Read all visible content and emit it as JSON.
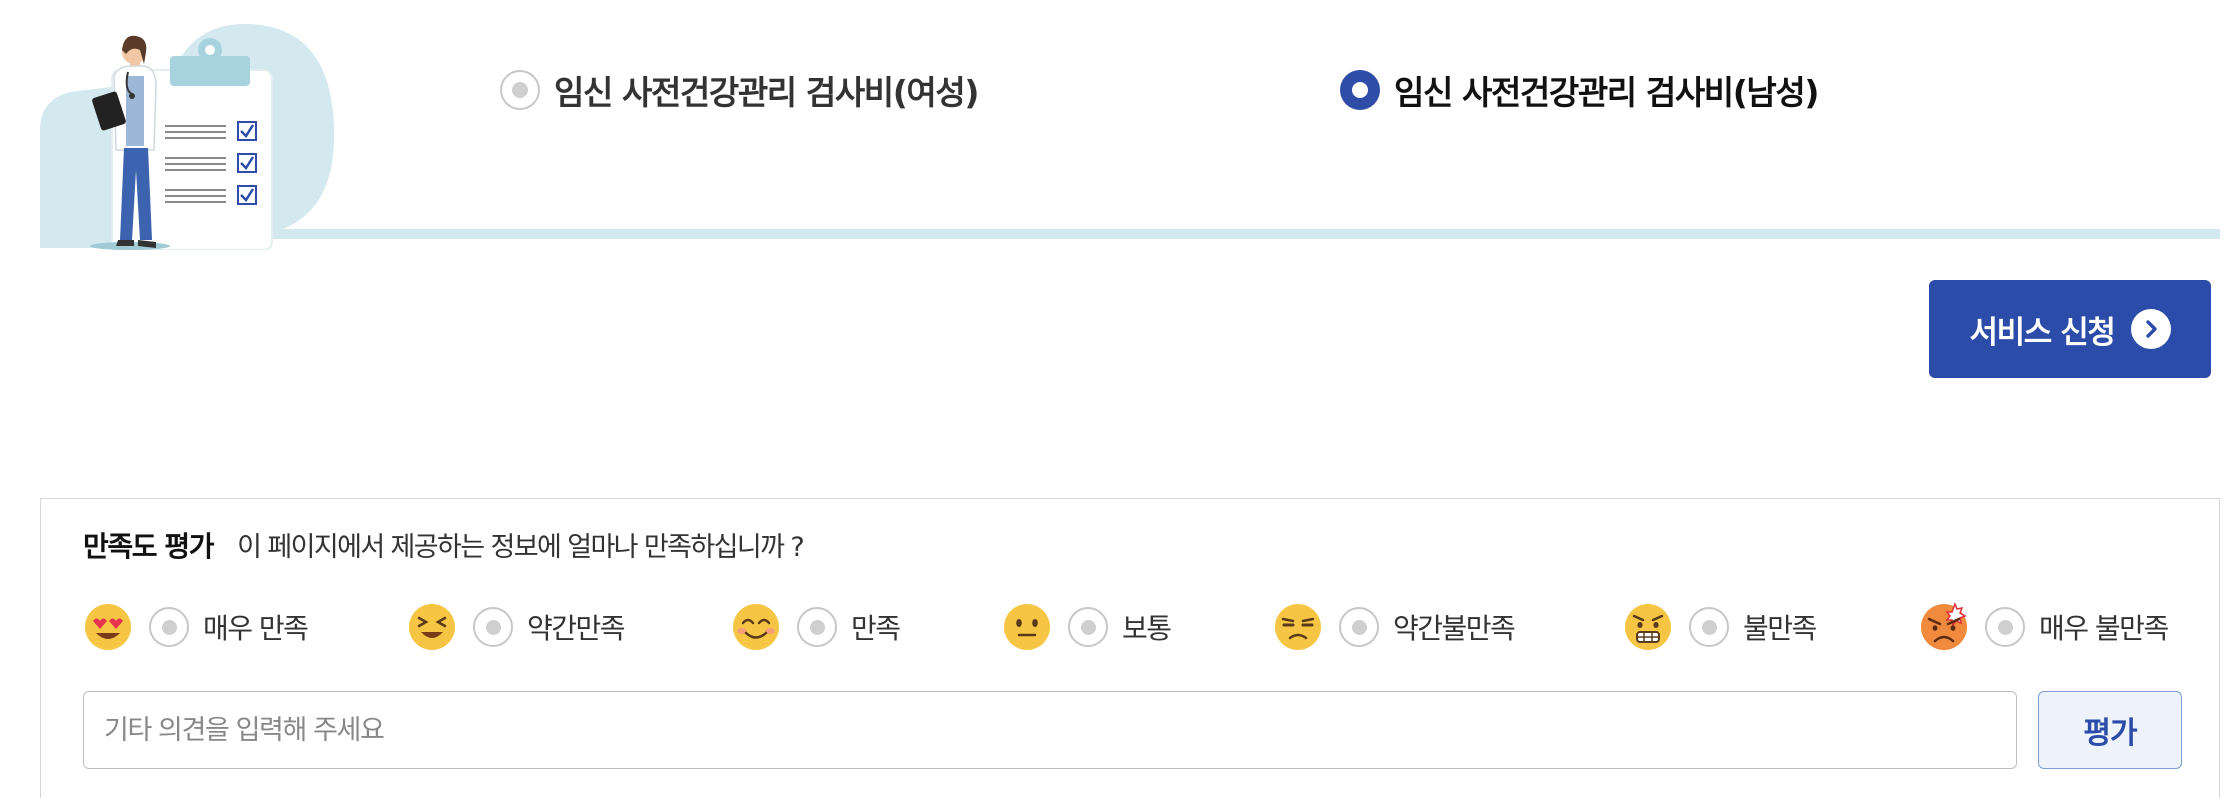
{
  "selection": {
    "options": [
      {
        "label": "임신 사전건강관리 검사비(여성)",
        "checked": false
      },
      {
        "label": "임신 사전건강관리 검사비(남성)",
        "checked": true
      }
    ]
  },
  "service_button": {
    "label": "서비스 신청",
    "icon": "chevron-right-icon"
  },
  "survey": {
    "title": "만족도 평가",
    "question": "이 페이지에서 제공하는 정보에 얼마나 만족하십니까 ?",
    "choices": [
      {
        "label": "매우 만족",
        "icon": "heart-eyes-face-icon"
      },
      {
        "label": "약간만족",
        "icon": "squinting-face-icon"
      },
      {
        "label": "만족",
        "icon": "smiling-face-icon"
      },
      {
        "label": "보통",
        "icon": "neutral-face-icon"
      },
      {
        "label": "약간불만족",
        "icon": "unamused-face-icon"
      },
      {
        "label": "불만족",
        "icon": "grimacing-face-icon"
      },
      {
        "label": "매우 불만족",
        "icon": "angry-face-icon"
      }
    ],
    "input_placeholder": "기타 의견을 입력해 주세요",
    "input_value": "",
    "submit_label": "평가"
  },
  "colors": {
    "primary": "#2c4ca9",
    "accent_line": "#d3e8ef",
    "emoji_yellow": "#f6c543",
    "angry_orange": "#f08a3c"
  }
}
